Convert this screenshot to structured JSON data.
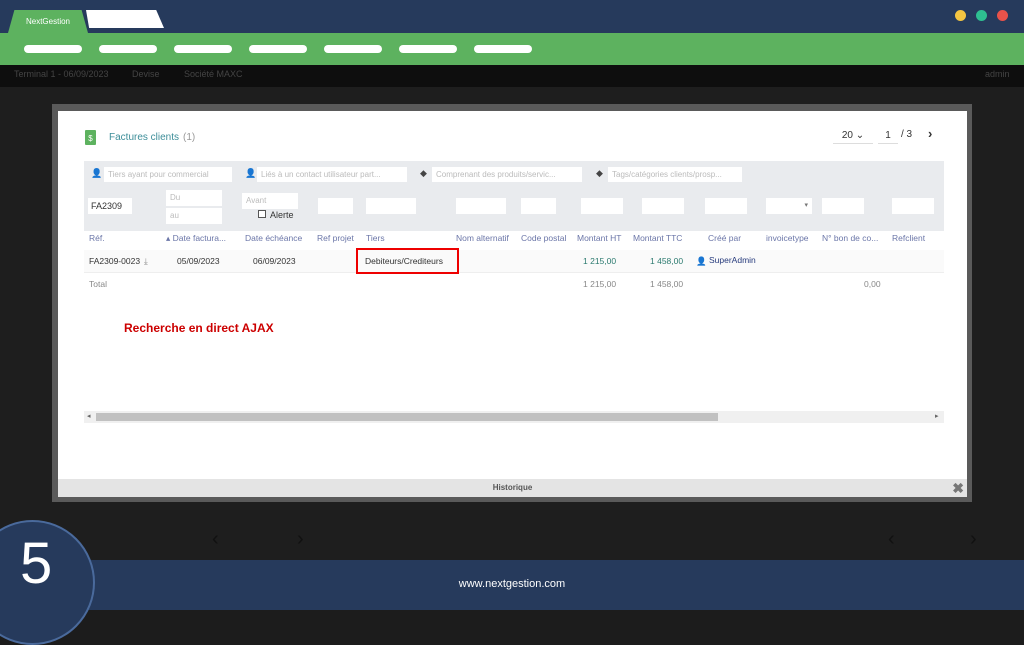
{
  "app": {
    "brand": "NextGestion",
    "window_dots": [
      "#f4c542",
      "#2ebf91",
      "#e8524a"
    ]
  },
  "toolbar": {
    "terminal": "Terminal 1 - 06/09/2023",
    "devise": "Devise",
    "societe": "Société MAXC",
    "user": "admin"
  },
  "modal": {
    "title": "Factures clients",
    "count": "(1)",
    "pagination": {
      "per_page": "20",
      "page": "1",
      "total_pages": "/ 3"
    },
    "filters": {
      "commercial": "Tiers ayant pour commercial",
      "contact": "Liés à un contact utilisateur part...",
      "produits": "Comprenant des produits/servic...",
      "tags": "Tags/catégories clients/prosp..."
    },
    "search": {
      "ref": "FA2309",
      "du": "Du",
      "au": "au",
      "avant": "Avant",
      "alerte": "Alerte"
    },
    "columns": [
      "Réf.",
      "Date factura...",
      "Date échéance",
      "Ref projet",
      "Tiers",
      "Nom alternatif",
      "Code postal",
      "Montant HT",
      "Montant TTC",
      "Créé par",
      "invoicetype",
      "N° bon de co...",
      "Refclient"
    ],
    "row": {
      "ref": "FA2309-0023",
      "date": "05/09/2023",
      "echeance": "06/09/2023",
      "tiers": "Debiteurs/Crediteurs",
      "ht": "1 215,00",
      "ttc": "1 458,00",
      "cree_par": "SuperAdmin"
    },
    "total": {
      "label": "Total",
      "ht": "1 215,00",
      "ttc": "1 458,00",
      "bon": "0,00"
    },
    "annotation": "Recherche en direct AJAX",
    "footer": "Historique"
  },
  "footer": {
    "step": "5",
    "url": "www.nextgestion.com"
  }
}
